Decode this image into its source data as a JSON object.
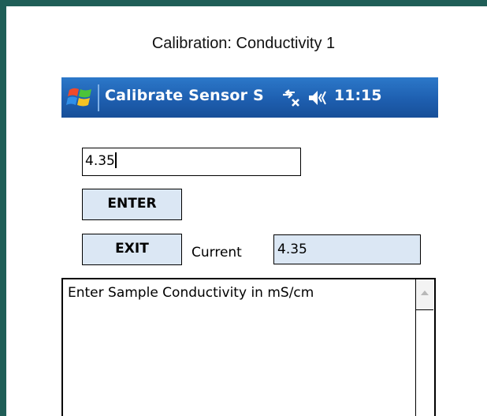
{
  "caption": "Calibration: Conductivity 1",
  "window": {
    "title": "Calibrate Sensor S",
    "clock": "11:15"
  },
  "form": {
    "value_input": "4.35",
    "enter_label": "ENTER",
    "exit_label": "EXIT",
    "current_label": "Current",
    "current_value": "4.35"
  },
  "message": "Enter Sample Conductivity in mS/cm",
  "colors": {
    "frame": "#1f5e57",
    "titlebar": "#1e5fb0",
    "button_fill": "#dbe7f4"
  },
  "icons": [
    "windows-start-icon",
    "connectivity-icon",
    "volume-icon",
    "scroll-up-arrow-icon"
  ]
}
